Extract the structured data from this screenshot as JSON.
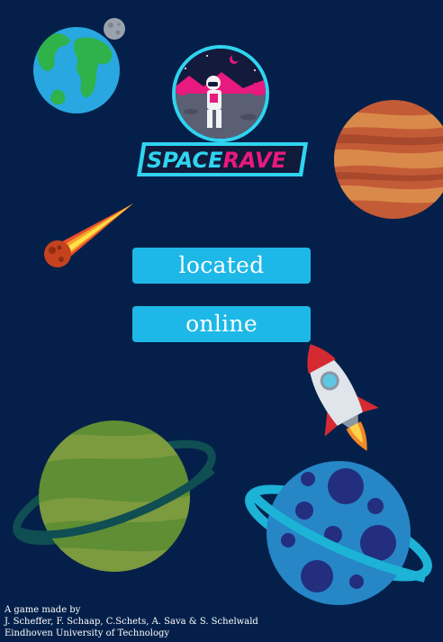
{
  "game": {
    "logo_text_part1": "SPACE",
    "logo_text_part2": "RAVE"
  },
  "menu": {
    "buttons": [
      {
        "label": "located"
      },
      {
        "label": "online"
      }
    ]
  },
  "credits": {
    "line1": "A game made by",
    "line2": "J. Scheffer, F. Schaap, C.Schets, A. Sava & S. Schelwald",
    "line3": "Eindhoven University of Technology"
  },
  "colors": {
    "background": "#04204a",
    "button": "#1db8e8",
    "logo_cyan": "#2fd4f0",
    "logo_pink": "#e8197f"
  },
  "icons": [
    "earth-icon",
    "moon-icon",
    "meteor-icon",
    "jupiter-icon",
    "rocket-icon",
    "green-ringed-planet-icon",
    "blue-ringed-planet-icon",
    "astronaut-logo-icon"
  ]
}
